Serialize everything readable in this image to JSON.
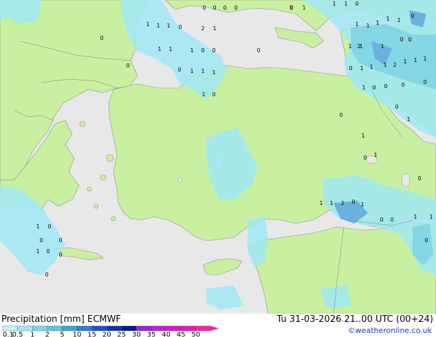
{
  "footer": {
    "title_left": "Precipitation [mm]  ECMWF",
    "title_right": "Tu 31-03-2026 21..00 UTC (00+24)",
    "credit": "©weatheronline.co.uk"
  },
  "legend": {
    "unit": "mm",
    "ticks": [
      "0.1",
      "0.5",
      "1",
      "2",
      "5",
      "10",
      "15",
      "20",
      "25",
      "30",
      "35",
      "40",
      "45",
      "50"
    ],
    "colors": [
      "#c6f2f7",
      "#a5e6f2",
      "#7fd6ec",
      "#5ec4e6",
      "#3aa5dc",
      "#2a7fd0",
      "#1f52c4",
      "#1233a8",
      "#0a1a8a",
      "#a020d8",
      "#c020d8",
      "#d818c8",
      "#e818b8",
      "#f028a8"
    ]
  },
  "map": {
    "land_color": "#c8f0a0",
    "sea_color": "#e8e8e8",
    "precip_light": "#a0e8f4",
    "precip_mid": "#78d2f0",
    "precip_heavy": "#5aa8e8",
    "precip_labels": [
      {
        "t": "1"
      },
      {
        "t": "1"
      },
      {
        "t": "1"
      },
      {
        "t": "0"
      },
      {
        "t": "2"
      },
      {
        "t": "1"
      },
      {
        "t": "0"
      },
      {
        "t": "0"
      },
      {
        "t": "0"
      },
      {
        "t": "0"
      },
      {
        "t": "1"
      },
      {
        "t": "1"
      },
      {
        "t": "1"
      },
      {
        "t": "0"
      },
      {
        "t": "1"
      },
      {
        "t": "1"
      },
      {
        "t": "1"
      },
      {
        "t": "1"
      },
      {
        "t": "0"
      },
      {
        "t": "0"
      },
      {
        "t": "1"
      },
      {
        "t": "1"
      },
      {
        "t": "1"
      },
      {
        "t": "2"
      },
      {
        "t": "1"
      },
      {
        "t": "0"
      },
      {
        "t": "1"
      },
      {
        "t": "1"
      },
      {
        "t": "2"
      },
      {
        "t": "1"
      },
      {
        "t": "1"
      },
      {
        "t": "1"
      },
      {
        "t": "0"
      },
      {
        "t": "1"
      },
      {
        "t": "1"
      },
      {
        "t": "1"
      },
      {
        "t": "0"
      },
      {
        "t": "1"
      },
      {
        "t": "1"
      },
      {
        "t": "0"
      },
      {
        "t": "1"
      },
      {
        "t": "1"
      },
      {
        "t": "1"
      },
      {
        "t": "1"
      },
      {
        "t": "0"
      },
      {
        "t": "0"
      },
      {
        "t": "0"
      },
      {
        "t": "0"
      },
      {
        "t": "0"
      },
      {
        "t": "0"
      },
      {
        "t": "0"
      },
      {
        "t": "0"
      },
      {
        "t": "0"
      },
      {
        "t": "0"
      },
      {
        "t": "1"
      },
      {
        "t": "0"
      },
      {
        "t": "1"
      },
      {
        "t": "0"
      },
      {
        "t": "1"
      },
      {
        "t": "1"
      },
      {
        "t": "0"
      },
      {
        "t": "0"
      },
      {
        "t": "1"
      },
      {
        "t": "2"
      },
      {
        "t": "1"
      },
      {
        "t": "0"
      },
      {
        "t": "1"
      },
      {
        "t": "0"
      },
      {
        "t": "0"
      },
      {
        "t": "1"
      },
      {
        "t": "1"
      },
      {
        "t": "0"
      },
      {
        "t": "1"
      },
      {
        "t": "0"
      },
      {
        "t": "0"
      },
      {
        "t": "0"
      },
      {
        "t": "1"
      },
      {
        "t": "0"
      },
      {
        "t": "0"
      },
      {
        "t": "0"
      }
    ]
  }
}
